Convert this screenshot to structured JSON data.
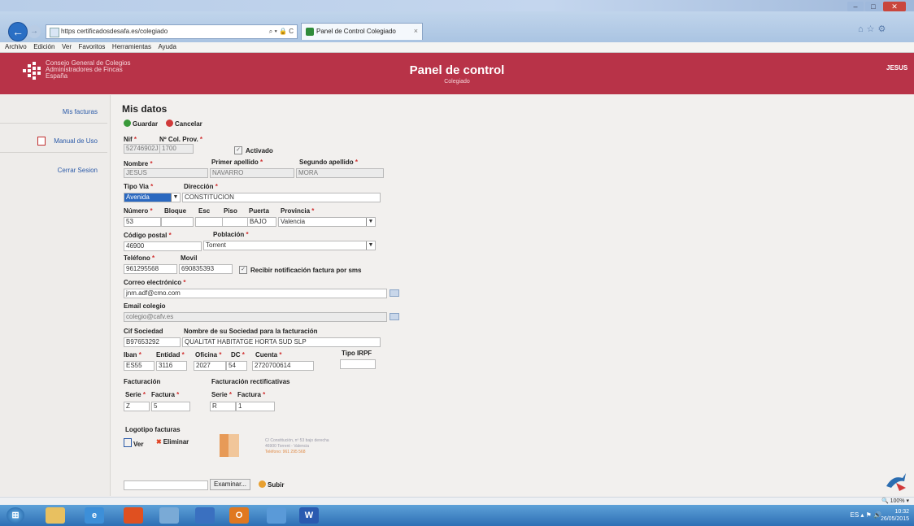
{
  "browser": {
    "url": "https   certificadosdesafa.es/colegiado",
    "addr_controls": "⌕ ▾ 🔒 C",
    "tab_title": "Panel de Control Colegiado",
    "tab_close": "×",
    "menu": [
      "Archivo",
      "Edición",
      "Ver",
      "Favoritos",
      "Herramientas",
      "Ayuda"
    ]
  },
  "header": {
    "org_line1": "Consejo General de Colegios",
    "org_line2": "Administradores de Fincas",
    "org_line3": "España",
    "title": "Panel de control",
    "subtitle": "Colegiado",
    "user": "JESUS"
  },
  "sidebar": {
    "items": [
      {
        "label": "Mis facturas"
      },
      {
        "label": "Manual de Uso",
        "icon": "pdf-icon"
      },
      {
        "label": "Cerrar Sesion"
      }
    ]
  },
  "form": {
    "title": "Mis datos",
    "guardar": "Guardar",
    "cancelar": "Cancelar",
    "nif_label": "Nif",
    "nif": "52746902J",
    "colprov_label": "Nº Col. Prov.",
    "colprov": "1700",
    "activado": "Activado",
    "nombre_label": "Nombre",
    "nombre": "JESUS",
    "apellido1_label": "Primer apellido",
    "apellido1": "NAVARRO",
    "apellido2_label": "Segundo apellido",
    "apellido2": "MORA",
    "tipovia_label": "Tipo Via",
    "tipovia": "Avenida",
    "direccion_label": "Dirección",
    "direccion": "CONSTITUCION",
    "numero_label": "Número",
    "bloque_label": "Bloque",
    "esc_label": "Esc",
    "piso_label": "Piso",
    "puerta_label": "Puerta",
    "provincia_label": "Provincia",
    "numero": "53",
    "puerta": "BAJO",
    "provincia": "Valencia",
    "cp_label": "Código postal",
    "cp": "46900",
    "poblacion_label": "Población",
    "poblacion": "Torrent",
    "telefono_label": "Teléfono",
    "movil_label": "Movil",
    "telefono": "961295568",
    "movil": "690835393",
    "sms": "Recibir notificación factura por sms",
    "correo_label": "Correo electrónico",
    "correo": "jnm.adf@cmo.com",
    "emailcol_label": "Email colegio",
    "emailcol": "colegio@cafv.es",
    "cif_label": "Cif Sociedad",
    "sociedad_label": "Nombre de su Sociedad para la facturación",
    "cif": "B97653292",
    "sociedad": "QUALITAT HABITATGE HORTA SUD SLP",
    "iban_label": "Iban",
    "entidad_label": "Entidad",
    "oficina_label": "Oficina",
    "dc_label": "DC",
    "cuenta_label": "Cuenta",
    "irpf_label": "Tipo IRPF",
    "iban": "ES55",
    "entidad": "3116",
    "oficina": "2027",
    "dc": "54",
    "cuenta": "2720700614",
    "facturacion_label": "Facturación",
    "rect_label": "Facturación rectificativas",
    "serie_label": "Serie",
    "factura_label": "Factura",
    "serie1": "Z",
    "factura1": "5",
    "serie2": "R",
    "factura2": "1",
    "logotipo_label": "Logotipo facturas",
    "ver": "Ver",
    "eliminar": "Eliminar",
    "logo_text1": "C/ Constitución, nº 53 bajo derecha",
    "logo_text2": "46900 Torrent - Valencia",
    "logo_text3": "Teléfono: 961 295 568",
    "examinar": "Examinar...",
    "subir": "Subir"
  },
  "status": {
    "zoom": "100%"
  },
  "taskbar": {
    "lang": "ES",
    "time": "10:32",
    "date": "26/05/2015"
  },
  "colors": {
    "header": "#b83348",
    "link": "#2b5aa8",
    "required": "#d03030"
  }
}
